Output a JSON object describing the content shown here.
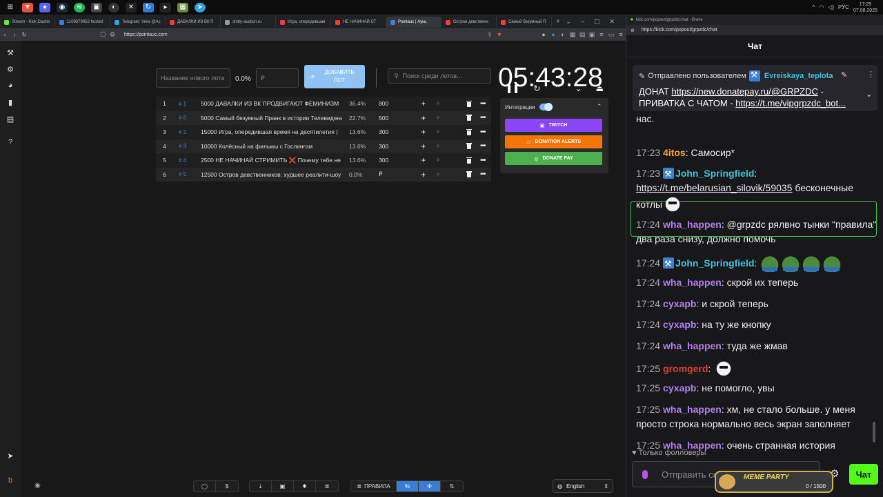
{
  "taskbar": {
    "time": "17:25",
    "date": "07.08.2025",
    "lang": "РУС"
  },
  "left_browser": {
    "tabs": [
      {
        "label": "Stream - Kick Dashb",
        "color": "#53fc18"
      },
      {
        "label": "1109379952 hosted",
        "color": "#3b82d6"
      },
      {
        "label": "Telegram: View @Ac",
        "color": "#2aa3e0"
      },
      {
        "label": "ДАВАЛКИ ИЗ ВК П",
        "color": "#ff3b3b"
      },
      {
        "label": "shitty-auction.ru",
        "color": "#999999"
      },
      {
        "label": "Игра, опередившая",
        "color": "#ff3b3b"
      },
      {
        "label": "НЕ НАЧИНАЙ СТ",
        "color": "#ff3b3b"
      },
      {
        "label": "Pointauc | Аукц",
        "color": "#3b82d6"
      },
      {
        "label": "Остров девственн",
        "color": "#ff3b3b"
      },
      {
        "label": "Самый безумный П",
        "color": "#ff3b3b"
      }
    ],
    "url": "https://pointauc.com"
  },
  "auction": {
    "new_lot_placeholder": "Название нового лота",
    "percent": "0.0%",
    "amount_placeholder": "₽",
    "add_button": "ДОБАВИТЬ ПОТ",
    "search_placeholder": "Поиск среди лотов...",
    "timer": "05:43:28",
    "lots": [
      {
        "idx": "1",
        "id": "# 1",
        "name": "5000 ДАВАЛКИ ИЗ ВК ПРОДВИГАЮТ ФЕМИНИЗМ",
        "percent": "36.4%",
        "amount": "800",
        "rub": "₽"
      },
      {
        "idx": "2",
        "id": "# 6",
        "name": "5000 Самый безумный Пранк в истории Телевидения",
        "percent": "22.7%",
        "amount": "500",
        "rub": "₽"
      },
      {
        "idx": "3",
        "id": "# 2",
        "name": "15000 Игра, опередившая время на десятилетия |",
        "percent": "13.6%",
        "amount": "300",
        "rub": "₽"
      },
      {
        "idx": "4",
        "id": "# 3",
        "name": "10000 Колёсный на фильмы с Гослингом",
        "percent": "13.6%",
        "amount": "300",
        "rub": "₽"
      },
      {
        "idx": "5",
        "id": "# 4",
        "name": "2500 НЕ НАЧИНАЙ СТРИМИТЬ ❌ Почему тебе не",
        "percent": "13.6%",
        "amount": "300",
        "rub": "₽"
      },
      {
        "idx": "6",
        "id": "# 5",
        "name": "12500 Остров девственников: худшее реалити-шоу",
        "percent": "0.0%",
        "amount": "₽",
        "rub": "₽"
      }
    ],
    "integrations_label": "Интеграции",
    "integrations": [
      {
        "label": "TWITCH",
        "color": "#8c44f7"
      },
      {
        "label": "DONATION ALERTS",
        "color": "#f57507"
      },
      {
        "label": "DONATE PAY",
        "color": "#4caf50"
      }
    ],
    "bottom": {
      "rules_label": "ПРАВИЛА",
      "language": "English"
    }
  },
  "chat": {
    "window_url_small": "kick.com/popout/grpzdc/chat - Brave",
    "url": "https://kick.com/popout/grpzdc/chat",
    "title": "Чат",
    "pinned_by_prefix": "Отправлено пользователем",
    "pinned_by_user": "Evreiskaya_teplota",
    "pinned_text_1": "ДОНАТ ",
    "pinned_link_1": "https://new.donatepay.ru/@GRPZDC",
    "pinned_text_2": " - ПРИВАТКА С ЧАТОМ - ",
    "pinned_link_2": "https://t.me/vipgrpzdc_bot...",
    "partial_top": "нас.",
    "messages": [
      {
        "time": "17:23",
        "user": "4itos",
        "color": "#f4a23c",
        "text": "Самосир*"
      },
      {
        "time": "17:23",
        "user": "John_Springfield",
        "color": "#3ec3d8",
        "text": "https://t.me/belarusian_silovik/59035",
        "text2": " бесконечные котлы"
      },
      {
        "time": "17:24",
        "user": "wha_happen",
        "color": "#b57ef0",
        "text": "@grpzdc рялвно тынки \"правила\" два раза снизу, должно помочь"
      },
      {
        "time": "17:24",
        "user": "John_Springfield",
        "color": "#3ec3d8",
        "text": ""
      },
      {
        "time": "17:24",
        "user": "wha_happen",
        "color": "#b57ef0",
        "text": "скрой их теперь"
      },
      {
        "time": "17:24",
        "user": "сухарb",
        "color": "#b57ef0",
        "text": "и скрой теперь"
      },
      {
        "time": "17:24",
        "user": "сухарb",
        "color": "#b57ef0",
        "text": "на ту же кнопку"
      },
      {
        "time": "17:24",
        "user": "wha_happen",
        "color": "#b57ef0",
        "text": "туда же жмав"
      },
      {
        "time": "17:25",
        "user": "gromgerd",
        "color": "#e23b3b",
        "text": ""
      },
      {
        "time": "17:25",
        "user": "сухарb",
        "color": "#b57ef0",
        "text": "не помогло, увы"
      },
      {
        "time": "17:25",
        "user": "wha_happen",
        "color": "#b57ef0",
        "text": "хм, не стало больше. у меня просто строка нормально весь экран заполняет"
      },
      {
        "time": "17:25",
        "user": "wha_happen",
        "color": "#b57ef0",
        "text": "очень странная история"
      }
    ],
    "followers_only": "Только фолловеры",
    "input_placeholder": "Отправить сообщение",
    "send_label": "Чат",
    "meme_party_title": "MEME PARTY",
    "meme_party_count": "0 / 1500"
  }
}
